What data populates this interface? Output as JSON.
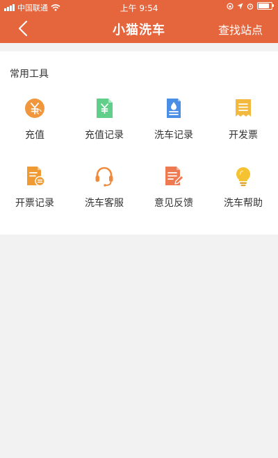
{
  "status_bar": {
    "carrier": "中国联通",
    "time": "上午 9:54",
    "battery_level": 0.85
  },
  "nav": {
    "title": "小猫洗车",
    "action_label": "查找站点"
  },
  "tools": {
    "section_title": "常用工具",
    "items": [
      {
        "label": "充值",
        "icon": "yuan-coin-icon",
        "color": "#f0963c"
      },
      {
        "label": "充值记录",
        "icon": "yuan-document-icon",
        "color": "#5fcf8a"
      },
      {
        "label": "洗车记录",
        "icon": "water-drop-document-icon",
        "color": "#4a8ee6"
      },
      {
        "label": "开发票",
        "icon": "receipt-icon",
        "color": "#f3b83e"
      },
      {
        "label": "开票记录",
        "icon": "invoice-record-icon",
        "color": "#ef9a33"
      },
      {
        "label": "洗车客服",
        "icon": "headset-icon",
        "color": "#ef8a3c"
      },
      {
        "label": "意见反馈",
        "icon": "feedback-edit-icon",
        "color": "#ee7a52"
      },
      {
        "label": "洗车帮助",
        "icon": "lightbulb-icon",
        "color": "#f5c232"
      }
    ]
  },
  "colors": {
    "brand": "#e5653d",
    "background": "#f2f2f2"
  }
}
